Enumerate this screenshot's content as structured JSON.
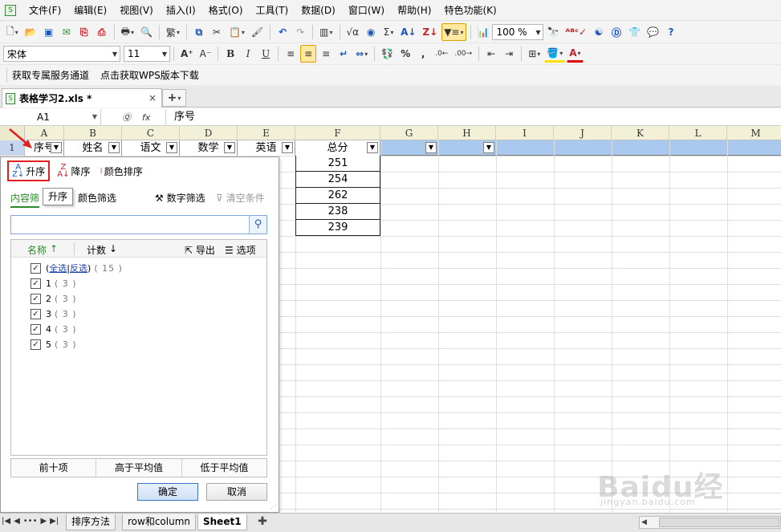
{
  "menubar": {
    "items": [
      "文件(F)",
      "编辑(E)",
      "视图(V)",
      "插入(I)",
      "格式(O)",
      "工具(T)",
      "数据(D)",
      "窗口(W)",
      "帮助(H)",
      "特色功能(K)"
    ]
  },
  "toolbar1": {
    "trad": "繁",
    "zoom": "100 %",
    "sigma": "Σ"
  },
  "toolbar2": {
    "font": "宋体",
    "size": "11",
    "percent": "%"
  },
  "toolbar3": {
    "promo1": "获取专属服务通道",
    "promo2": "点击获取WPS版本下载"
  },
  "doc": {
    "tab_title": "表格学习2.xls *",
    "close": "×",
    "new_tab": "+"
  },
  "formula": {
    "cell_ref": "A1",
    "value": "序号"
  },
  "columns": [
    "A",
    "B",
    "C",
    "D",
    "E",
    "F",
    "G",
    "H",
    "I",
    "J",
    "K",
    "L",
    "M"
  ],
  "row1_number": "1",
  "headers": [
    "序号",
    "姓名",
    "语文",
    "数学",
    "英语",
    "总分"
  ],
  "totals": [
    "251",
    "254",
    "262",
    "238",
    "239"
  ],
  "popup": {
    "asc": "升序",
    "desc": "降序",
    "color_sort": "颜色排序",
    "tooltip": "升序",
    "tab_content": "内容筛",
    "tab_color": "颜色筛选",
    "tab_number": "数字筛选",
    "tab_clear": "清空条件",
    "search_placeholder": "",
    "list_head_name": "名称",
    "list_head_count": "计数",
    "export": "导出",
    "options": "选项",
    "select_all": "全选",
    "invert": "反选",
    "total_count": "15",
    "items": [
      {
        "label": "1",
        "count": "3"
      },
      {
        "label": "2",
        "count": "3"
      },
      {
        "label": "3",
        "count": "3"
      },
      {
        "label": "4",
        "count": "3"
      },
      {
        "label": "5",
        "count": "3"
      }
    ],
    "top10": "前十项",
    "above_avg": "高于平均值",
    "below_avg": "低于平均值",
    "ok": "确定",
    "cancel": "取消"
  },
  "sheets": [
    "排序方法",
    "row和column",
    "Sheet1"
  ],
  "watermark": {
    "main": "Baidu经验",
    "sub": "jingyan.baidu.com"
  },
  "colors": {
    "row_highlight": "#a9c9ee",
    "header_bg": "#f3f0d8",
    "accent_red": "#e02020"
  }
}
